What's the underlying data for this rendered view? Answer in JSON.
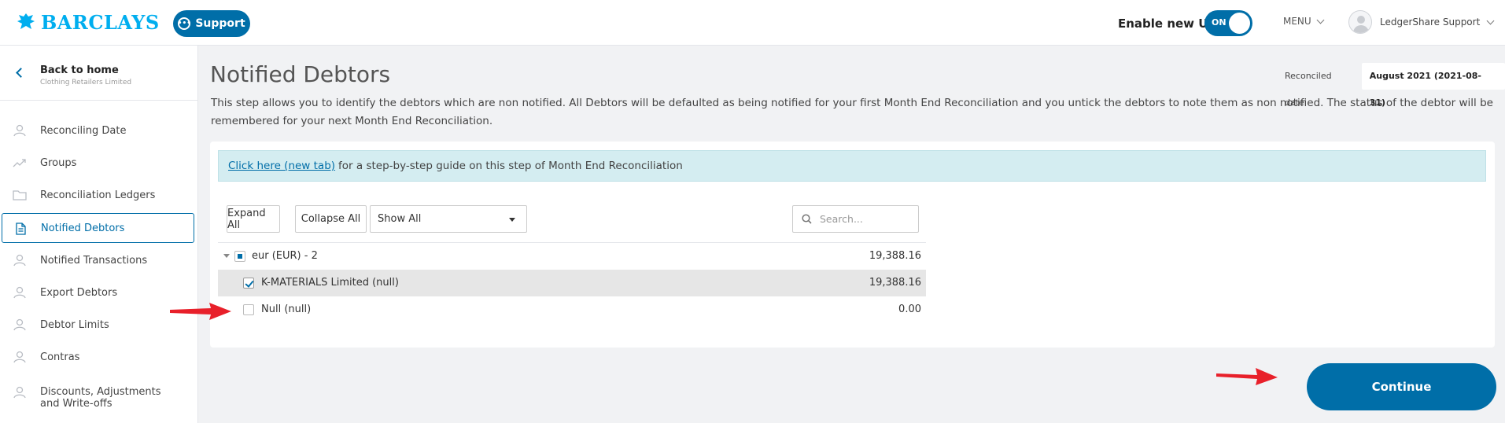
{
  "header": {
    "brand": "BARCLAYS",
    "support_label": "Support",
    "new_ui_label": "Enable new UI",
    "toggle_state": "ON",
    "menu_label": "MENU",
    "user_name": "LedgerShare Support"
  },
  "sidebar": {
    "back_title": "Back to home",
    "back_subtitle": "Clothing Retailers Limited",
    "items": [
      {
        "label": "Reconciling Date",
        "icon": "user-icon"
      },
      {
        "label": "Groups",
        "icon": "trend-icon"
      },
      {
        "label": "Reconciliation Ledgers",
        "icon": "folder-icon"
      },
      {
        "label": "Notified Debtors",
        "icon": "document-icon",
        "active": true
      },
      {
        "label": "Notified Transactions",
        "icon": "user-icon"
      },
      {
        "label": "Export Debtors",
        "icon": "user-icon"
      },
      {
        "label": "Debtor Limits",
        "icon": "user-icon"
      },
      {
        "label": "Contras",
        "icon": "user-icon"
      },
      {
        "label": "Discounts, Adjustments and Write-offs",
        "icon": "user-icon"
      }
    ]
  },
  "main": {
    "title": "Notified Debtors",
    "reconciled_date_label": "Reconciled date",
    "reconciled_date_value": "August 2021 (2021-08-31)",
    "description": "This step allows you to identify the debtors which are non notified. All Debtors will be defaulted as being notified for your first Month End Reconciliation and you untick the debtors to note them as non notified. The status of the debtor will be remembered for your next Month End Reconciliation.",
    "guide_link": "Click here (new tab)",
    "guide_text": "for a step-by-step guide on this step of Month End Reconciliation",
    "expand_all": "Expand All",
    "collapse_all": "Collapse All",
    "filter_selected": "Show All",
    "search_placeholder": "Search...",
    "tree": {
      "group": {
        "label": "eur (EUR) - 2",
        "value": "19,388.16",
        "state": "partial"
      },
      "rows": [
        {
          "label": "K-MATERIALS Limited (null)",
          "value": "19,388.16",
          "checked": true
        },
        {
          "label": "Null (null)",
          "value": "0.00",
          "checked": false
        }
      ]
    },
    "continue_label": "Continue"
  },
  "colors": {
    "brand_blue": "#006ea8",
    "logo_cyan": "#00aeef",
    "annotation_red": "#e8202a"
  }
}
